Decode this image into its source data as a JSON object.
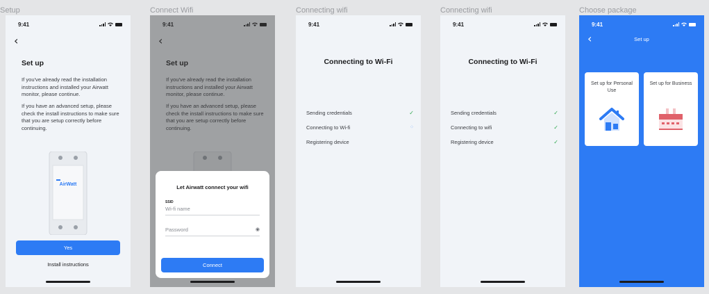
{
  "screens": [
    {
      "label": "Setup"
    },
    {
      "label": "Connect Wifi"
    },
    {
      "label": "Connecting wifi"
    },
    {
      "label": "Connecting wifi"
    },
    {
      "label": "Choose package"
    }
  ],
  "status_time": "9:41",
  "setup": {
    "title": "Set up",
    "para1": "If you've already read the installation instructions and installed your Airwatt monitor, please continue.",
    "para2": "If you have an advanced setup, please check the install instructions to make sure that you are setup correctly before continuing.",
    "device_brand": "AirWatt",
    "yes_label": "Yes",
    "install_label": "Install instructions"
  },
  "wifi_sheet": {
    "title": "Let Airwatt connect your wifi",
    "ssid_label": "SSID",
    "ssid_placeholder": "Wi-fi name",
    "password_placeholder": "Password",
    "connect_label": "Connect"
  },
  "connecting1": {
    "title": "Connecting to Wi-Fi",
    "steps": [
      "Sending credentials",
      "Connecting to Wi-fi",
      "Registering device"
    ],
    "states": [
      "done",
      "loading",
      "pending"
    ]
  },
  "connecting2": {
    "title": "Connecting to Wi-Fi",
    "steps": [
      "Sending credentials",
      "Connecting to wifi",
      "Registering device"
    ],
    "states": [
      "done",
      "done",
      "done"
    ]
  },
  "package": {
    "nav_title": "Set up",
    "personal_label": "Set up for Personal Use",
    "business_label": "Set up for Business"
  },
  "colors": {
    "accent": "#2d7bf4",
    "success": "#2fa84f",
    "home_icon": "#2d7bf4",
    "business_icon": "#e0616a"
  }
}
